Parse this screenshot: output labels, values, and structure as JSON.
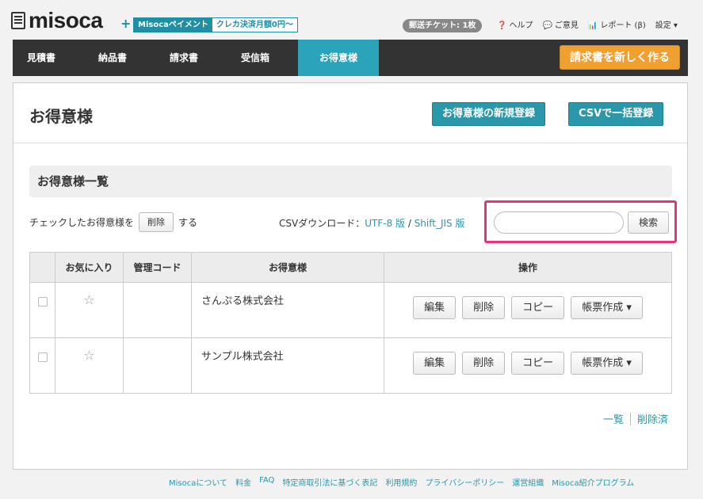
{
  "header": {
    "logo_text": "misoca",
    "plus": "+",
    "promo_name": "Misocaペイメント",
    "promo_offer": "クレカ決済月額0円〜",
    "ticket": "郵送チケット: 1枚",
    "links": [
      {
        "icon": "question-icon",
        "glyph": "❓",
        "label": "ヘルプ"
      },
      {
        "icon": "speech-bubble-icon",
        "glyph": "💬",
        "label": "ご意見"
      },
      {
        "icon": "chart-icon",
        "glyph": "📊",
        "label": "レポート (β)"
      },
      {
        "icon": "chevron-down-icon",
        "glyph": "",
        "label": "設定 ▾"
      }
    ]
  },
  "nav": {
    "items": [
      "見積書",
      "納品書",
      "請求書",
      "受信箱",
      "お得意様"
    ],
    "active_index": 4,
    "new_invoice_label": "請求書を新しく作る"
  },
  "page": {
    "title": "お得意様",
    "new_client_button": "お得意様の新規登録",
    "csv_import_button": "CSVで一括登録",
    "list_heading": "お得意様一覧",
    "bulk_prefix": "チェックしたお得意様を",
    "bulk_delete_button": "削除",
    "bulk_suffix": "する",
    "csv_label": "CSVダウンロード：",
    "csv_utf8": "UTF-8 版",
    "csv_sep": " / ",
    "csv_sjis": "Shift_JIS 版",
    "search_value": "",
    "search_button": "検索"
  },
  "table": {
    "headers": [
      "",
      "お気に入り",
      "管理コード",
      "お得意様",
      "操作"
    ],
    "rows": [
      {
        "favorite": "☆",
        "code": "",
        "name": "さんぷる株式会社"
      },
      {
        "favorite": "☆",
        "code": "",
        "name": "サンプル株式会社"
      }
    ],
    "actions": [
      "編集",
      "削除",
      "コピー",
      "帳票作成 ▾"
    ]
  },
  "list_links": {
    "all": "一覧",
    "deleted": "削除済"
  },
  "footer": {
    "links": [
      "Misocaについて",
      "料金",
      "FAQ",
      "特定商取引法に基づく表記",
      "利用規約",
      "プライバシーポリシー",
      "運営組織",
      "Misoca紹介プログラム"
    ]
  },
  "colors": {
    "accent": "#2a97aa",
    "nav_bg": "#333333",
    "cta": "#f0a030",
    "highlight": "#e8337a"
  }
}
